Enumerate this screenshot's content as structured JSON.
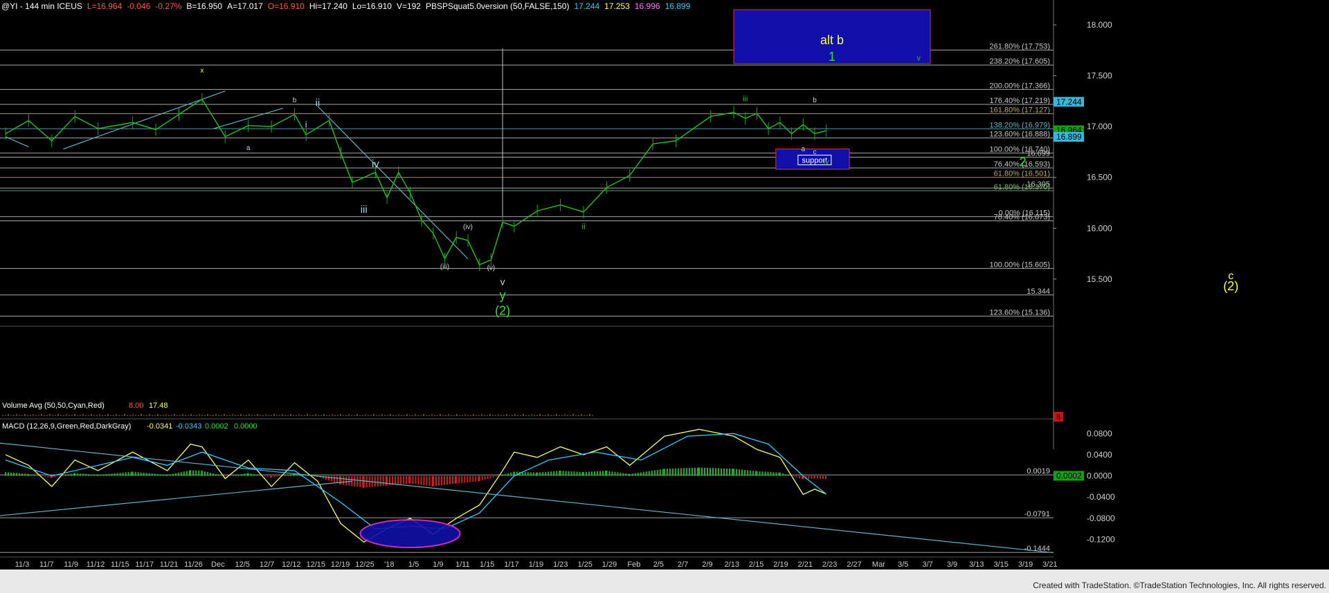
{
  "header": {
    "items": [
      {
        "text": "@YI - 144 min  ICEUS",
        "color": "#ffffff"
      },
      {
        "text": "L=16.964",
        "color": "#ff5555"
      },
      {
        "text": "-0.046",
        "color": "#ff5555"
      },
      {
        "text": "-0.27%",
        "color": "#ff5555"
      },
      {
        "text": "B=16.950",
        "color": "#ffffff"
      },
      {
        "text": "A=17.017",
        "color": "#ffffff"
      },
      {
        "text": "O=16.910",
        "color": "#ff5555"
      },
      {
        "text": "Hi=17.240",
        "color": "#ffffff"
      },
      {
        "text": "Lo=16.910",
        "color": "#ffffff"
      },
      {
        "text": "V=192",
        "color": "#ffffff"
      },
      {
        "text": "PBSPSquat5.0version (50,FALSE,150)",
        "color": "#ffffff"
      },
      {
        "text": "17.244",
        "color": "#33ccff"
      },
      {
        "text": "17.253",
        "color": "#ffff66"
      },
      {
        "text": "16.996",
        "color": "#ff77ff"
      },
      {
        "text": "16.899",
        "color": "#33ccff"
      }
    ]
  },
  "chart_data": {
    "type": "line",
    "price_axis": {
      "ticks": [
        "18.000",
        "17.500",
        "17.000",
        "16.500",
        "16.000",
        "15.500"
      ],
      "range": [
        15.05,
        18.15
      ]
    },
    "price_badges": [
      {
        "value": 17.244,
        "label": "17.244",
        "bg": "#3ab7d8"
      },
      {
        "value": 16.964,
        "label": "16.964",
        "bg": "#14a014"
      },
      {
        "value": 16.899,
        "label": "16.899",
        "bg": "#3ab7d8"
      }
    ],
    "x_ticks": [
      "11/3",
      "11/7",
      "11/9",
      "11/12",
      "11/15",
      "11/17",
      "11/21",
      "11/26",
      "Dec",
      "12/5",
      "12/7",
      "12/12",
      "12/15",
      "12/19",
      "12/25",
      "'18",
      "1/5",
      "1/9",
      "1/11",
      "1/15",
      "1/17",
      "1/19",
      "1/23",
      "1/25",
      "1/29",
      "Feb",
      "2/5",
      "2/7",
      "2/9",
      "2/13",
      "2/15",
      "2/19",
      "2/21",
      "2/23",
      "2/27",
      "Mar",
      "3/5",
      "3/7",
      "3/9",
      "3/13",
      "3/15",
      "3/19",
      "3/21"
    ],
    "fib_levels": [
      {
        "label": "261.80% (17.753)",
        "value": 17.753,
        "color": "#c8c8c8"
      },
      {
        "label": "238.20% (17.605)",
        "value": 17.605,
        "color": "#c8c8c8"
      },
      {
        "label": "200.00% (17.366)",
        "value": 17.366,
        "color": "#c8c8c8"
      },
      {
        "label": "176.40% (17.219)",
        "value": 17.219,
        "color": "#c8c8c8"
      },
      {
        "label": "161.80% (17.127)",
        "value": 17.127,
        "color": "#b8a86a"
      },
      {
        "label": "138.20% (16.979)",
        "value": 16.979,
        "color": "#5fb3c9"
      },
      {
        "label": "123.60% (16.888)",
        "value": 16.888,
        "color": "#c8c8c8"
      },
      {
        "label": "100.00% (16.740)",
        "value": 16.74,
        "color": "#c8c8c8"
      },
      {
        "label": "16.699",
        "value": 16.699,
        "color": "#c8c8c8"
      },
      {
        "label": "76.40% (16.593)",
        "value": 16.593,
        "color": "#c8c8c8"
      },
      {
        "label": "61.80% (16.501)",
        "value": 16.501,
        "color": "#b8a86a"
      },
      {
        "label": "16.395",
        "value": 16.395,
        "color": "#c8c8c8"
      },
      {
        "label": "61.80% (16.370)",
        "value": 16.37,
        "color": "#6fbf6f"
      },
      {
        "label": "0.00% (16.115)",
        "value": 16.115,
        "color": "#c8c8c8"
      },
      {
        "label": "78.40% (16.073)",
        "value": 16.073,
        "color": "#c8c8c8"
      },
      {
        "label": "100.00% (15.605)",
        "value": 15.605,
        "color": "#c8c8c8"
      },
      {
        "label": "15.344",
        "value": 15.344,
        "color": "#c8c8c8"
      },
      {
        "label": "123.60% (15.136)",
        "value": 15.136,
        "color": "#c8c8c8"
      }
    ],
    "price_series": [
      {
        "x": "11/1",
        "y": 16.93
      },
      {
        "x": "11/3",
        "y": 17.06
      },
      {
        "x": "11/5",
        "y": 16.86
      },
      {
        "x": "11/7",
        "y": 17.1
      },
      {
        "x": "11/9",
        "y": 16.98
      },
      {
        "x": "11/12",
        "y": 17.04
      },
      {
        "x": "11/14",
        "y": 16.97
      },
      {
        "x": "11/16",
        "y": 17.12
      },
      {
        "x": "11/18",
        "y": 17.27
      },
      {
        "x": "11/20",
        "y": 16.9
      },
      {
        "x": "11/22",
        "y": 17.01
      },
      {
        "x": "11/24",
        "y": 17.0
      },
      {
        "x": "11/26",
        "y": 17.12
      },
      {
        "x": "11/27",
        "y": 16.92
      },
      {
        "x": "11/29",
        "y": 17.06
      },
      {
        "x": "11/30",
        "y": 16.74
      },
      {
        "x": "12/1",
        "y": 16.45
      },
      {
        "x": "12/3",
        "y": 16.55
      },
      {
        "x": "12/4",
        "y": 16.3
      },
      {
        "x": "12/5",
        "y": 16.55
      },
      {
        "x": "12/6",
        "y": 16.35
      },
      {
        "x": "12/7",
        "y": 16.08
      },
      {
        "x": "12/8",
        "y": 15.95
      },
      {
        "x": "12/9",
        "y": 15.7
      },
      {
        "x": "12/10",
        "y": 15.91
      },
      {
        "x": "12/11",
        "y": 15.88
      },
      {
        "x": "12/12",
        "y": 15.64
      },
      {
        "x": "12/13",
        "y": 15.69
      },
      {
        "x": "12/14",
        "y": 16.06
      },
      {
        "x": "12/15",
        "y": 16.02
      },
      {
        "x": "12/17",
        "y": 16.17
      },
      {
        "x": "12/19",
        "y": 16.23
      },
      {
        "x": "12/21",
        "y": 16.16
      },
      {
        "x": "12/23",
        "y": 16.4
      },
      {
        "x": "12/25",
        "y": 16.52
      },
      {
        "x": "12/27",
        "y": 16.83
      },
      {
        "x": "12/29",
        "y": 16.86
      },
      {
        "x": "1/1",
        "y": 17.1
      },
      {
        "x": "1/3",
        "y": 17.14
      },
      {
        "x": "1/4",
        "y": 17.08
      },
      {
        "x": "1/5",
        "y": 17.13
      },
      {
        "x": "1/6",
        "y": 16.98
      },
      {
        "x": "1/7",
        "y": 17.04
      },
      {
        "x": "1/8",
        "y": 16.93
      },
      {
        "x": "1/9",
        "y": 17.02
      },
      {
        "x": "1/10",
        "y": 16.93
      },
      {
        "x": "1/11",
        "y": 16.96
      }
    ],
    "wave_labels": [
      {
        "text": "x",
        "x": "11/18",
        "y": 17.53,
        "color": "#ffff33",
        "size": 10
      },
      {
        "text": "a",
        "x": "11/22",
        "y": 16.77,
        "color": "#c0d8e8",
        "size": 10
      },
      {
        "text": "b",
        "x": "11/26",
        "y": 17.24,
        "color": "#c0d8e8",
        "size": 10
      },
      {
        "text": "ii",
        "x": "11/28",
        "y": 17.2,
        "color": "#9bd2ee",
        "size": 15
      },
      {
        "text": "i",
        "x": "11/27",
        "y": 16.99,
        "color": "#c0d8e8",
        "size": 13
      },
      {
        "text": "iv",
        "x": "12/3",
        "y": 16.6,
        "color": "#9bd2ee",
        "size": 15
      },
      {
        "text": "iii",
        "x": "12/2",
        "y": 16.15,
        "color": "#9bd2ee",
        "size": 15
      },
      {
        "text": "(iv)",
        "x": "12/11",
        "y": 15.99,
        "color": "#d0d0d0",
        "size": 10
      },
      {
        "text": "(iii)",
        "x": "12/9",
        "y": 15.6,
        "color": "#d0d0d0",
        "size": 10
      },
      {
        "text": "(v)",
        "x": "12/13",
        "y": 15.59,
        "color": "#d0d0d0",
        "size": 10
      },
      {
        "text": "v",
        "x": "12/14",
        "y": 15.44,
        "color": "#c0d8e8",
        "size": 14
      },
      {
        "text": "y",
        "x": "12/14",
        "y": 15.3,
        "color": "#33dd33",
        "size": 18
      },
      {
        "text": "(2)",
        "x": "12/14",
        "y": 15.15,
        "color": "#33dd33",
        "size": 18
      },
      {
        "text": "ii",
        "x": "12/21",
        "y": 15.99,
        "color": "#33bb33",
        "size": 12
      },
      {
        "text": "iii",
        "x": "1/4",
        "y": 17.25,
        "color": "#33bb33",
        "size": 11
      },
      {
        "text": "b",
        "x": "1/10",
        "y": 17.24,
        "color": "#c0d8e8",
        "size": 10
      },
      {
        "text": "a",
        "x": "1/9",
        "y": 16.76,
        "color": "#c0d8e8",
        "size": 10
      },
      {
        "text": "c",
        "x": "1/10",
        "y": 16.73,
        "color": "#c0d8e8",
        "size": 10
      },
      {
        "text": "iv",
        "x": "1/11",
        "y": 16.63,
        "color": "#33bb33",
        "size": 11
      },
      {
        "text": "v",
        "x": "1/19",
        "y": 17.65,
        "color": "#33bb33",
        "size": 11
      },
      {
        "text": "2",
        "x": "1/28",
        "y": 16.61,
        "color": "#33dd33",
        "size": 18
      },
      {
        "text": "c",
        "x": "2/15",
        "y": 15.5,
        "color": "#ffff33",
        "size": 16
      },
      {
        "text": "(2)",
        "x": "2/15",
        "y": 15.39,
        "color": "#ffff33",
        "size": 18
      }
    ],
    "alt_box": {
      "title": "alt b",
      "wave": "1"
    },
    "support_box": {
      "label": "support"
    },
    "volume_pane": {
      "label": "Volume Avg (50,50,Cyan,Red)",
      "values": [
        "8.00",
        "17.48"
      ],
      "badge": "8"
    },
    "macd_pane": {
      "label": "MACD (12,26,9,Green,Red,DarkGray)",
      "values": [
        "-0.0341",
        "-0.0343",
        "0.0002",
        "0.0000"
      ],
      "ticks": [
        "0.0800",
        "0.0400",
        "0.0000",
        "-0.0400",
        "-0.0800",
        "-0.1200"
      ],
      "range": [
        -0.135,
        0.1
      ],
      "levels": [
        {
          "label": "0.0019",
          "value": 0.0019
        },
        {
          "label": "-0.0791",
          "value": -0.0791
        },
        {
          "label": "-0.1444",
          "value": -0.1444
        }
      ],
      "badge": "0.0002",
      "macd_series": [
        {
          "x": "11/1",
          "y": 0.04
        },
        {
          "x": "11/3",
          "y": 0.02
        },
        {
          "x": "11/5",
          "y": -0.02
        },
        {
          "x": "11/7",
          "y": 0.03
        },
        {
          "x": "11/9",
          "y": 0.01
        },
        {
          "x": "11/12",
          "y": 0.045
        },
        {
          "x": "11/15",
          "y": 0.01
        },
        {
          "x": "11/17",
          "y": 0.06
        },
        {
          "x": "11/18",
          "y": 0.055
        },
        {
          "x": "11/20",
          "y": -0.005
        },
        {
          "x": "11/22",
          "y": 0.03
        },
        {
          "x": "11/24",
          "y": -0.02
        },
        {
          "x": "11/26",
          "y": 0.025
        },
        {
          "x": "11/28",
          "y": -0.01
        },
        {
          "x": "11/30",
          "y": -0.09
        },
        {
          "x": "12/2",
          "y": -0.125
        },
        {
          "x": "12/4",
          "y": -0.1
        },
        {
          "x": "12/6",
          "y": -0.08
        },
        {
          "x": "12/8",
          "y": -0.11
        },
        {
          "x": "12/10",
          "y": -0.08
        },
        {
          "x": "12/12",
          "y": -0.055
        },
        {
          "x": "12/14",
          "y": 0.01
        },
        {
          "x": "12/15",
          "y": 0.045
        },
        {
          "x": "12/17",
          "y": 0.035
        },
        {
          "x": "12/19",
          "y": 0.055
        },
        {
          "x": "12/21",
          "y": 0.04
        },
        {
          "x": "12/23",
          "y": 0.055
        },
        {
          "x": "12/25",
          "y": 0.02
        },
        {
          "x": "12/28",
          "y": 0.075
        },
        {
          "x": "12/31",
          "y": 0.088
        },
        {
          "x": "1/3",
          "y": 0.075
        },
        {
          "x": "1/5",
          "y": 0.05
        },
        {
          "x": "1/7",
          "y": 0.035
        },
        {
          "x": "1/9",
          "y": -0.035
        },
        {
          "x": "1/10",
          "y": -0.025
        },
        {
          "x": "1/11",
          "y": -0.0341
        }
      ],
      "signal_series": [
        {
          "x": "11/1",
          "y": 0.03
        },
        {
          "x": "11/5",
          "y": 0.0
        },
        {
          "x": "11/9",
          "y": 0.02
        },
        {
          "x": "11/12",
          "y": 0.035
        },
        {
          "x": "11/15",
          "y": 0.02
        },
        {
          "x": "11/18",
          "y": 0.045
        },
        {
          "x": "11/22",
          "y": 0.015
        },
        {
          "x": "11/26",
          "y": 0.01
        },
        {
          "x": "11/30",
          "y": -0.05
        },
        {
          "x": "12/3",
          "y": -0.1
        },
        {
          "x": "12/6",
          "y": -0.095
        },
        {
          "x": "12/9",
          "y": -0.1
        },
        {
          "x": "12/12",
          "y": -0.07
        },
        {
          "x": "12/15",
          "y": 0.0
        },
        {
          "x": "12/18",
          "y": 0.03
        },
        {
          "x": "12/22",
          "y": 0.045
        },
        {
          "x": "12/26",
          "y": 0.03
        },
        {
          "x": "12/30",
          "y": 0.075
        },
        {
          "x": "1/3",
          "y": 0.08
        },
        {
          "x": "1/6",
          "y": 0.06
        },
        {
          "x": "1/9",
          "y": 0.0
        },
        {
          "x": "1/11",
          "y": -0.0343
        }
      ]
    }
  },
  "footer": {
    "text": "Created with TradeStation. ©TradeStation Technologies, Inc. All rights reserved."
  }
}
